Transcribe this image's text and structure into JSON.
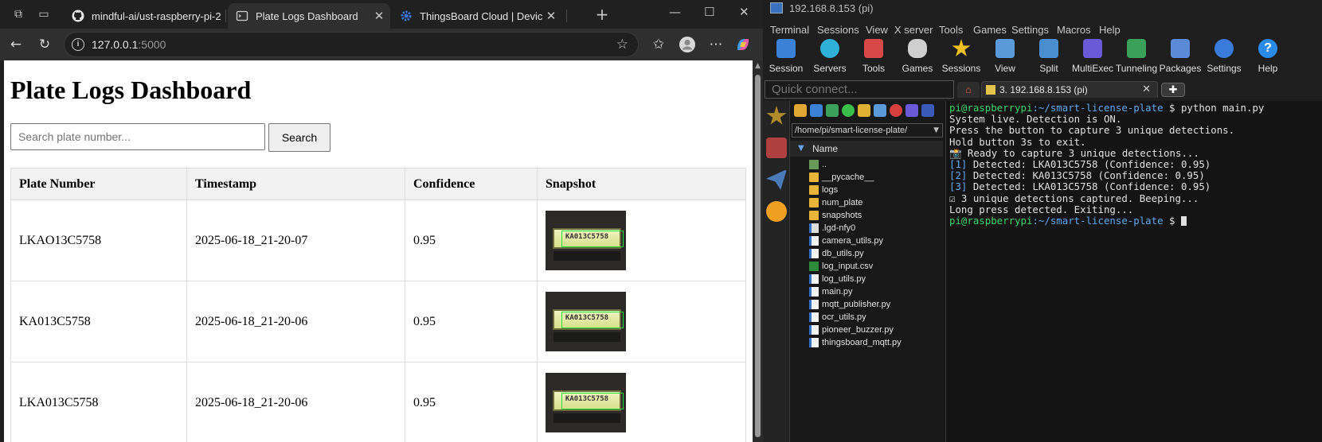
{
  "browser": {
    "tabs": [
      {
        "label": "mindful-ai/ust-raspberry-pi-2",
        "icon": "github-icon",
        "active": false
      },
      {
        "label": "Plate Logs Dashboard",
        "icon": "page-icon",
        "active": true
      },
      {
        "label": "ThingsBoard Cloud | Devices",
        "icon": "gear-icon",
        "active": false
      }
    ],
    "url_host": "127.0.0.1",
    "url_port": ":5000"
  },
  "page": {
    "title": "Plate Logs Dashboard",
    "search_placeholder": "Search plate number...",
    "search_button": "Search",
    "columns": [
      "Plate Number",
      "Timestamp",
      "Confidence",
      "Snapshot"
    ],
    "rows": [
      {
        "plate": "LKAO13C5758",
        "timestamp": "2025-06-18_21-20-07",
        "confidence": "0.95",
        "snapshot_text": "KA013C5758"
      },
      {
        "plate": "KA013C5758",
        "timestamp": "2025-06-18_21-20-06",
        "confidence": "0.95",
        "snapshot_text": "KA013C5758"
      },
      {
        "plate": "LKA013C5758",
        "timestamp": "2025-06-18_21-20-06",
        "confidence": "0.95",
        "snapshot_text": "KA013C5758"
      }
    ]
  },
  "moba": {
    "title": "192.168.8.153 (pi)",
    "menu": [
      "Terminal",
      "Sessions",
      "View",
      "X server",
      "Tools",
      "Games",
      "Settings",
      "Macros",
      "Help"
    ],
    "tools": [
      "Session",
      "Servers",
      "Tools",
      "Games",
      "Sessions",
      "View",
      "Split",
      "MultiExec",
      "Tunneling",
      "Packages",
      "Settings",
      "Help"
    ],
    "quick_connect_placeholder": "Quick connect...",
    "session_tab": "3. 192.168.8.153 (pi)",
    "sftp_path": "/home/pi/smart-license-plate/",
    "name_header": "Name",
    "files": [
      {
        "name": "..",
        "type": "up"
      },
      {
        "name": "__pycache__",
        "type": "folder"
      },
      {
        "name": "logs",
        "type": "folder"
      },
      {
        "name": "num_plate",
        "type": "folder"
      },
      {
        "name": "snapshots",
        "type": "folder"
      },
      {
        "name": ".lgd-nfy0",
        "type": "hidden"
      },
      {
        "name": "camera_utils.py",
        "type": "py"
      },
      {
        "name": "db_utils.py",
        "type": "py"
      },
      {
        "name": "log_input.csv",
        "type": "csv"
      },
      {
        "name": "log_utils.py",
        "type": "py"
      },
      {
        "name": "main.py",
        "type": "py"
      },
      {
        "name": "mqtt_publisher.py",
        "type": "py"
      },
      {
        "name": "ocr_utils.py",
        "type": "py"
      },
      {
        "name": "pioneer_buzzer.py",
        "type": "py"
      },
      {
        "name": "thingsboard_mqtt.py",
        "type": "py"
      }
    ],
    "terminal": {
      "prompt_user": "pi@raspberrypi",
      "prompt_path": ":~/smart-license-plate",
      "prompt_dollar": " $ ",
      "command": "python main.py",
      "lines": [
        "System live. Detection is ON.",
        "Press the button to capture 3 unique detections.",
        "Hold button 3s to exit.",
        "📸 Ready to capture 3 unique detections..."
      ],
      "detections": [
        {
          "idx": "[1]",
          "text": " Detected: LKA013C5758 (Confidence: 0.95)"
        },
        {
          "idx": "[2]",
          "text": " Detected: KA013C5758 (Confidence: 0.95)"
        },
        {
          "idx": "[3]",
          "text": " Detected: LKA013C5758 (Confidence: 0.95)"
        }
      ],
      "after": [
        "☑ 3 unique detections captured. Beeping...",
        "Long press detected. Exiting..."
      ]
    }
  },
  "colors": {
    "prompt_green": "#3cd66b",
    "prompt_blue": "#5fa8f0",
    "snapshot_box": "#17e33a"
  }
}
